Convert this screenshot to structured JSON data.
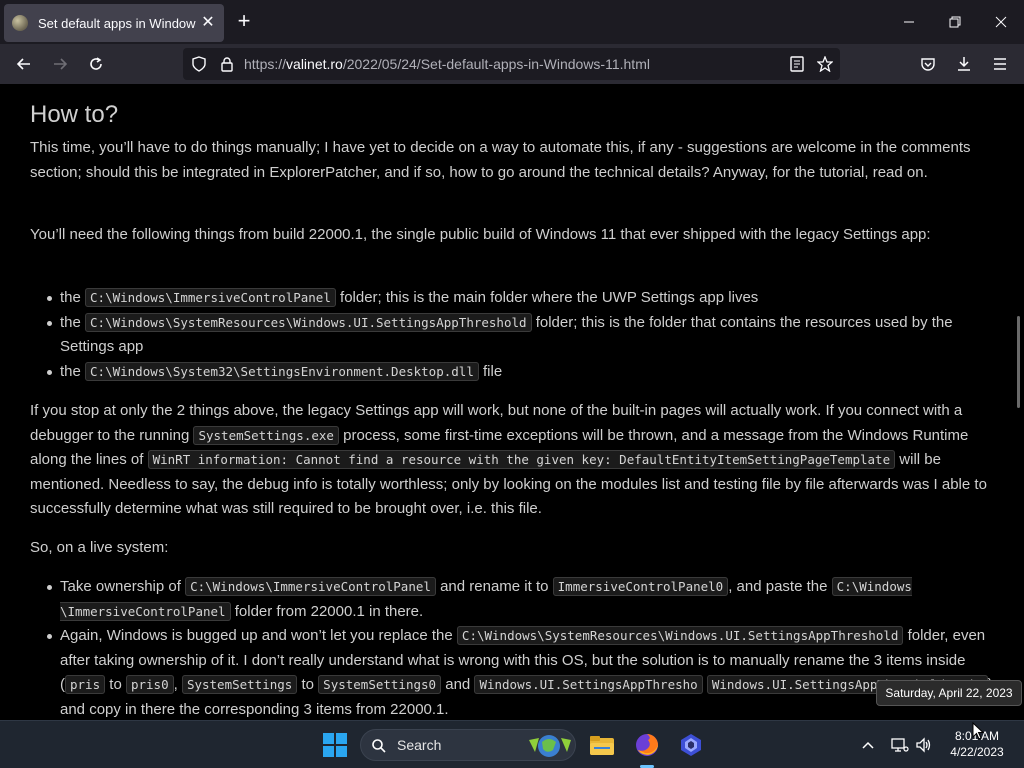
{
  "browser": {
    "tab_title": "Set default apps in Windows 11",
    "url_scheme": "https://",
    "url_host": "valinet.ro",
    "url_path": "/2022/05/24/Set-default-apps-in-Windows-11.html"
  },
  "article": {
    "heading": "How to?",
    "p1": "This time, you’ll have to do things manually; I have yet to decide on a way to automate this, if any - suggestions are welcome in the comments section; should this be integrated in ExplorerPatcher, and if so, how to go around the technical details? Anyway, for the tutorial, read on.",
    "p2": "You’ll need the following things from build 22000.1, the single public build of Windows 11 that ever shipped with the legacy Settings app:",
    "list1": [
      {
        "pre": "the ",
        "code": "C:\\Windows\\ImmersiveControlPanel",
        "post": " folder; this is the main folder where the UWP Settings app lives"
      },
      {
        "pre": "the ",
        "code": "C:\\Windows\\SystemResources\\Windows.UI.SettingsAppThreshold",
        "post": " folder; this is the folder that contains the resources used by the Settings app"
      },
      {
        "pre": "the ",
        "code": "C:\\Windows\\System32\\SettingsEnvironment.Desktop.dll",
        "post": " file"
      }
    ],
    "p3_a": "If you stop at only the 2 things above, the legacy Settings app will work, but none of the built-in pages will actually work. If you connect with a debugger to the running ",
    "p3_code1": "SystemSettings.exe",
    "p3_b": " process, some first-time exceptions will be thrown, and a message from the Windows Runtime along the lines of ",
    "p3_code2": "WinRT information: Cannot find a resource with the given key: DefaultEntityItemSettingPageTemplate",
    "p3_c": " will be mentioned. Needless to say, the debug info is totally worthless; only by looking on the modules list and testing file by file afterwards was I able to successfully determine what was still required to be brought over, i.e. this file.",
    "p4": "So, on a live system:",
    "l2a_1": "Take ownership of ",
    "l2a_code1": "C:\\Windows\\ImmersiveControlPanel",
    "l2a_2": " and rename it to ",
    "l2a_code2": "ImmersiveControlPanel0",
    "l2a_3": ", and paste the ",
    "l2a_code3": "C:\\Windows \\ImmersiveControlPanel",
    "l2a_4": " folder from 22000.1 in there.",
    "l2b_1": "Again, Windows is bugged up and won’t let you replace the ",
    "l2b_code1": "C:\\Windows\\SystemResources\\Windows.UI.SettingsAppThreshold",
    "l2b_2": " folder, even after taking ownership of it. I don’t really understand what is wrong with this OS, but the solution is to manually rename the 3 items inside (",
    "l2b_code2": "pris",
    "l2b_3": " to ",
    "l2b_code3": "pris0",
    "l2b_4": ", ",
    "l2b_code4": "SystemSettings",
    "l2b_5": " to ",
    "l2b_code5": "SystemSettings0",
    "l2b_6": " and ",
    "l2b_code6": "Windows.UI.SettingsAppThresho",
    "l2b_7": " ",
    "l2b_code7": "Windows.UI.SettingsAppThreshold.pri0",
    "l2b_8": ") and copy in there the corresponding 3 items from 22000.1."
  },
  "tooltip": "Saturday, April 22, 2023",
  "taskbar": {
    "search_label": "Search",
    "time": "8:01 AM",
    "date": "4/22/2023"
  },
  "colors": {
    "accent": "#2aa6f0",
    "tab_active": "#42414d",
    "content_bg": "#000000"
  }
}
